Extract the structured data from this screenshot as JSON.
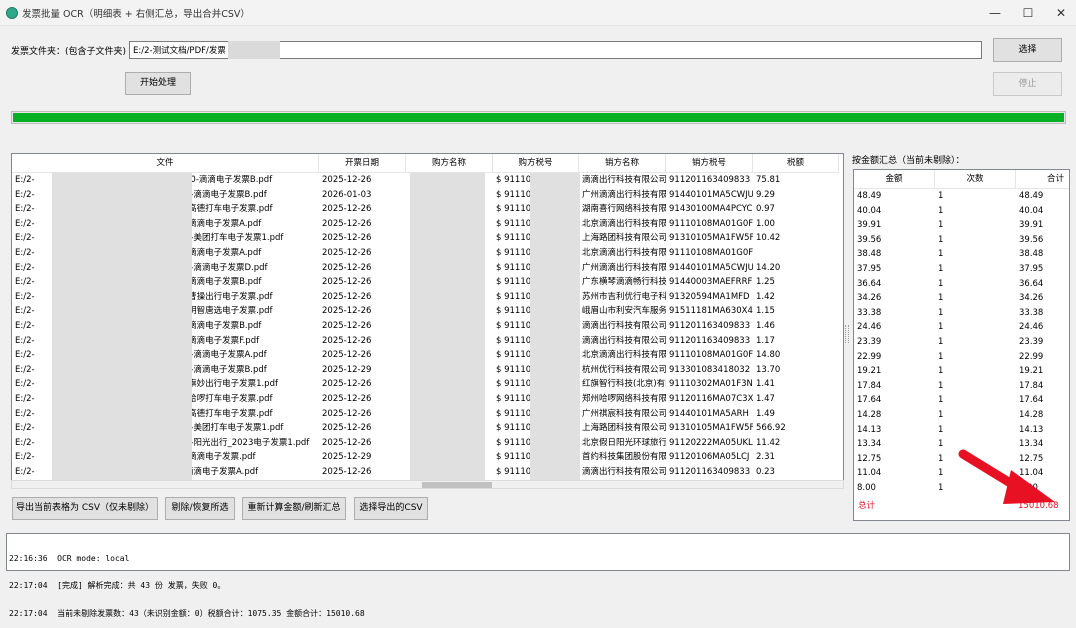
{
  "window": {
    "title": "发票批量 OCR（明细表 + 右侧汇总，导出合并CSV）",
    "minimize": "—",
    "maximize": "☐",
    "close": "✕",
    "app_icon": "green-circle-icon"
  },
  "folder": {
    "label": "发票文件夹：(包含子文件夹)",
    "value": "E:/2-测试文档/PDF/发票",
    "browse_label": "选择",
    "start_label": "开始处理",
    "stop_label": "停止"
  },
  "progress": {
    "value": 1.0,
    "color": "#06b025"
  },
  "table": {
    "columns": [
      "文件",
      "开票日期",
      "购方名称",
      "购方税号",
      "销方名称",
      "销方税号",
      "税额"
    ],
    "rows": [
      {
        "file_prefix": "E:/2-",
        "file": "30-滴滴电子发票B.pdf",
        "date": "2025-12-26",
        "buyer": "",
        "buyer_tax": "$ 911101",
        "seller": "滴滴出行科技有限公司",
        "seller_tax": "911201163409833",
        "tax": "75.81"
      },
      {
        "file_prefix": "E:/2-",
        "file": "2-滴滴电子发票B.pdf",
        "date": "2026-01-03",
        "buyer": "",
        "buyer_tax": "$ 911101",
        "seller": "广州滴滴出行科技有限公司",
        "seller_tax": "91440101MA5CWJU",
        "tax": "9.29"
      },
      {
        "file_prefix": "E:/2-",
        "file": "-高德打车电子发票.pdf",
        "date": "2025-12-26",
        "buyer": "",
        "buyer_tax": "$ 911101",
        "seller": "湖南喜行网络科技有限公司",
        "seller_tax": "91430100MA4PCYC",
        "tax": "0.97"
      },
      {
        "file_prefix": "E:/2-",
        "file": "-滴滴电子发票A.pdf",
        "date": "2025-12-26",
        "buyer": "",
        "buyer_tax": "$ 911101",
        "seller": "北京滴滴出行科技有限公司",
        "seller_tax": "91110108MA01G0F",
        "tax": "1.00"
      },
      {
        "file_prefix": "E:/2-",
        "file": "5-美团打车电子发票1.pdf",
        "date": "2025-12-26",
        "buyer": "",
        "buyer_tax": "$ 911101",
        "seller": "上海路团科技有限公司",
        "seller_tax": "91310105MA1FW5F",
        "tax": "10.42"
      },
      {
        "file_prefix": "E:/2-",
        "file": "-滴滴电子发票A.pdf",
        "date": "2025-12-26",
        "buyer": "",
        "buyer_tax": "$ 911101",
        "seller": "北京滴滴出行科技有限公司",
        "seller_tax": "91110108MA01G0F",
        "tax": ""
      },
      {
        "file_prefix": "E:/2-",
        "file": "7-滴滴电子发票D.pdf",
        "date": "2025-12-26",
        "buyer": "",
        "buyer_tax": "$ 911101",
        "seller": "广州滴滴出行科技有限公司",
        "seller_tax": "91440101MA5CWJU",
        "tax": "14.20"
      },
      {
        "file_prefix": "E:/2-",
        "file": "-滴滴电子发票B.pdf",
        "date": "2025-12-26",
        "buyer": "",
        "buyer_tax": "$ 911101",
        "seller": "广东横琴滴滴畅行科技有限公司",
        "seller_tax": "91440003MAEFRRF",
        "tax": "1.25"
      },
      {
        "file_prefix": "E:/2-",
        "file": "-曹操出行电子发票.pdf",
        "date": "2025-12-26",
        "buyer": "",
        "buyer_tax": "$ 911101",
        "seller": "苏州市吉利优行电子科技有限公司",
        "seller_tax": "91320594MA1MFD",
        "tax": "1.42"
      },
      {
        "file_prefix": "E:/2-",
        "file": "-明智唐选电子发票.pdf",
        "date": "2025-12-26",
        "buyer": "",
        "buyer_tax": "$ 911101",
        "seller": "峨眉山市利安汽车服务有限公司",
        "seller_tax": "91511181MA630X4",
        "tax": "1.15"
      },
      {
        "file_prefix": "E:/2-",
        "file": "-滴滴电子发票B.pdf",
        "date": "2025-12-26",
        "buyer": "",
        "buyer_tax": "$ 911101",
        "seller": "滴滴出行科技有限公司",
        "seller_tax": "911201163409833",
        "tax": "1.46"
      },
      {
        "file_prefix": "E:/2-",
        "file": "-滴滴电子发票F.pdf",
        "date": "2025-12-26",
        "buyer": "",
        "buyer_tax": "$ 911101",
        "seller": "滴滴出行科技有限公司",
        "seller_tax": "911201163409833",
        "tax": "1.17"
      },
      {
        "file_prefix": "E:/2-",
        "file": "0-滴滴电子发票A.pdf",
        "date": "2025-12-26",
        "buyer": "",
        "buyer_tax": "$ 911101",
        "seller": "北京滴滴出行科技有限公司",
        "seller_tax": "91110108MA01G0F",
        "tax": "14.80"
      },
      {
        "file_prefix": "E:/2-",
        "file": "4-滴滴电子发票B.pdf",
        "date": "2025-12-29",
        "buyer": "",
        "buyer_tax": "$ 911101",
        "seller": "杭州优行科技有限公司",
        "seller_tax": "913301083418032",
        "tax": "13.70"
      },
      {
        "file_prefix": "E:/2-",
        "file": "-旗妙出行电子发票1.pdf",
        "date": "2025-12-26",
        "buyer": "",
        "buyer_tax": "$ 911101",
        "seller": "红旗智行科技(北京)有限公司",
        "seller_tax": "91110302MA01F3N",
        "tax": "1.41"
      },
      {
        "file_prefix": "E:/2-",
        "file": "-哈啰打车电子发票.pdf",
        "date": "2025-12-26",
        "buyer": "",
        "buyer_tax": "$ 911101",
        "seller": "郑州哈啰网络科技有限公司",
        "seller_tax": "91120116MA07C3X",
        "tax": "1.47"
      },
      {
        "file_prefix": "E:/2-",
        "file": "-高德打车电子发票.pdf",
        "date": "2025-12-26",
        "buyer": "",
        "buyer_tax": "$ 911101",
        "seller": "广州祺宸科技有限公司",
        "seller_tax": "91440101MA5ARH",
        "tax": "1.49"
      },
      {
        "file_prefix": "E:/2-",
        "file": "2-美团打车电子发票1.pdf",
        "date": "2025-12-26",
        "buyer": "",
        "buyer_tax": "$ 911101",
        "seller": "上海路团科技有限公司",
        "seller_tax": "91310105MA1FW5F",
        "tax": "566.92"
      },
      {
        "file_prefix": "E:/2-",
        "file": "0-阳光出行_2023电子发票1.pdf",
        "date": "2025-12-26",
        "buyer": "",
        "buyer_tax": "$ 911101",
        "seller": "北京假日阳光环球旅行社有限公司",
        "seller_tax": "91120222MA05UKL",
        "tax": "11.42"
      },
      {
        "file_prefix": "E:/2-",
        "file": "-滴滴电子发票.pdf",
        "date": "2025-12-29",
        "buyer": "",
        "buyer_tax": "$ 911101",
        "seller": "首约科技集团股份有限公司",
        "seller_tax": "91120106MA05LCJ",
        "tax": "2.31"
      },
      {
        "file_prefix": "E:/2-",
        "file": "滴滴电子发票A.pdf",
        "date": "2025-12-26",
        "buyer": "",
        "buyer_tax": "$ 911101",
        "seller": "滴滴出行科技有限公司",
        "seller_tax": "911201163409833",
        "tax": "0.23"
      }
    ]
  },
  "summary": {
    "label": "按金额汇总（当前未剔除）：",
    "columns": [
      "金额",
      "次数",
      "合计"
    ],
    "rows": [
      [
        "48.49",
        "1",
        "48.49"
      ],
      [
        "40.04",
        "1",
        "40.04"
      ],
      [
        "39.91",
        "1",
        "39.91"
      ],
      [
        "39.56",
        "1",
        "39.56"
      ],
      [
        "38.48",
        "1",
        "38.48"
      ],
      [
        "37.95",
        "1",
        "37.95"
      ],
      [
        "36.64",
        "1",
        "36.64"
      ],
      [
        "34.26",
        "1",
        "34.26"
      ],
      [
        "33.38",
        "1",
        "33.38"
      ],
      [
        "24.46",
        "1",
        "24.46"
      ],
      [
        "23.39",
        "1",
        "23.39"
      ],
      [
        "22.99",
        "1",
        "22.99"
      ],
      [
        "19.21",
        "1",
        "19.21"
      ],
      [
        "17.84",
        "1",
        "17.84"
      ],
      [
        "17.64",
        "1",
        "17.64"
      ],
      [
        "14.28",
        "1",
        "14.28"
      ],
      [
        "14.13",
        "1",
        "14.13"
      ],
      [
        "13.34",
        "1",
        "13.34"
      ],
      [
        "12.75",
        "1",
        "12.75"
      ],
      [
        "11.04",
        "1",
        "11.04"
      ],
      [
        "8.00",
        "1",
        "8.00"
      ]
    ],
    "total_label": "总计",
    "total_value": "15010.68",
    "total_color": "#e81123",
    "arrow_color": "#e81123"
  },
  "actions": {
    "export_label": "导出当前表格为 CSV（仅未剔除）",
    "toggle_label": "剔除/恢复所选",
    "recalc_label": "重新计算金额/刷新汇总",
    "choose_export_label": "选择导出的CSV"
  },
  "log": {
    "lines": [
      "22:16:36  OCR mode: local",
      "22:17:04  [完成] 解析完成：共 43 份 发票，失败 0。",
      "22:17:04  当前未剔除发票数：43（未识别金额：0）税额合计：1075.35 金额合计：15010.68"
    ]
  }
}
